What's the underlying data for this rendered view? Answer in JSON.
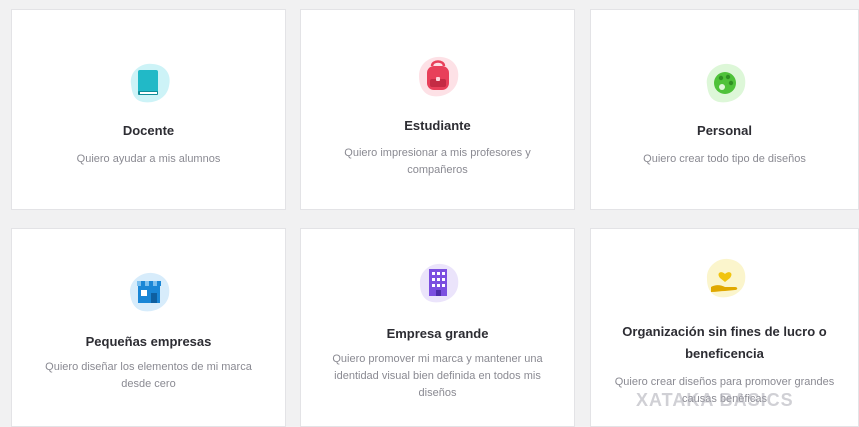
{
  "cards": [
    {
      "title": "Docente",
      "description": "Quiero ayudar a mis alumnos",
      "icon": "book-icon",
      "blob_color": "#cdf3f7",
      "accent_color": "#21b9c7"
    },
    {
      "title": "Estudiante",
      "description": "Quiero impresionar a mis profesores y compañeros",
      "icon": "backpack-icon",
      "blob_color": "#fde1e6",
      "accent_color": "#e8405a"
    },
    {
      "title": "Personal",
      "description": "Quiero crear todo tipo de diseños",
      "icon": "palette-icon",
      "blob_color": "#ddf7d8",
      "accent_color": "#4fc23a"
    },
    {
      "title": "Pequeñas empresas",
      "description": "Quiero diseñar los elementos de mi marca desde cero",
      "icon": "storefront-icon",
      "blob_color": "#d7ecfb",
      "accent_color": "#1a86d6"
    },
    {
      "title": "Empresa grande",
      "description": "Quiero promover mi marca y mantener una identidad visual bien definida en todos mis diseños",
      "icon": "office-building-icon",
      "blob_color": "#ebe4fb",
      "accent_color": "#7b4fe0"
    },
    {
      "title": "Organización sin fines de lucro o beneficencia",
      "description": "Quiero crear diseños para promover grandes causas benéficas",
      "icon": "heart-hand-icon",
      "blob_color": "#fbf5cc",
      "accent_color": "#f1c40f"
    }
  ],
  "watermark": "XATAKA BASICS"
}
